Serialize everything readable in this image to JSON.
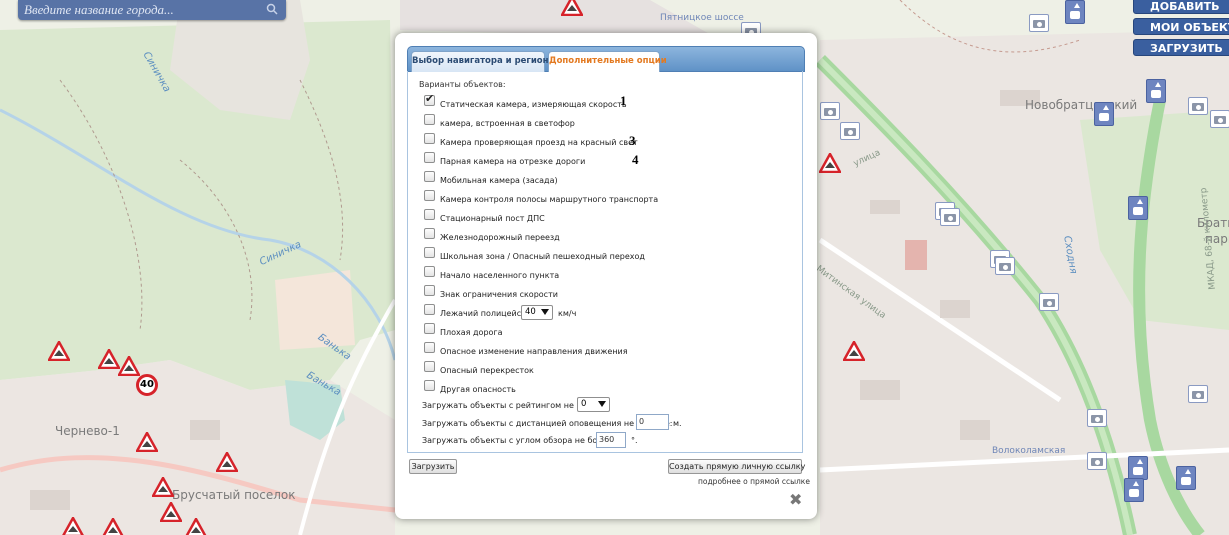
{
  "search": {
    "placeholder": "Введите название города..."
  },
  "top_buttons": [
    "ДОБАВИТЬ",
    "МОИ ОБЪЕКТЫ",
    "ЗАГРУЗИТЬ"
  ],
  "map_labels": {
    "novobratsevsky": "Новобратцевский",
    "chernevo": "Чернево-1",
    "brusyatiy": "Брусчатый поселок",
    "pyatnitskoe": "Пятницкое шоссе",
    "skhodnya": "Сходня",
    "sinichka_1": "Синичка",
    "sinichka_2": "Синичка",
    "banka_1": "Банька",
    "banka_2": "Банька",
    "mitinskaya": "Митинская улица",
    "volokolamskaya": "Волоколамская",
    "bratsevo": "Братцево",
    "park": "парк",
    "mkad": "МКАД, 68-й километр",
    "ulitsa": "улица"
  },
  "speed_sign": "40",
  "dialog": {
    "tabs": [
      {
        "label": "Выбор навигатора и региона",
        "active": false
      },
      {
        "label": "Дополнительные опции",
        "active": true
      }
    ],
    "options_title": "Варианты объектов:",
    "options": [
      {
        "label": "Статическая камера, измеряющая скорость",
        "checked": true
      },
      {
        "label": "камера, встроенная в светофор",
        "checked": false
      },
      {
        "label": "Камера проверяющая проезд на красный свет",
        "checked": false
      },
      {
        "label": "Парная камера на отрезке дороги",
        "checked": false
      },
      {
        "label": "Мобильная камера (засада)",
        "checked": false
      },
      {
        "label": "Камера контроля полосы маршрутного транспорта",
        "checked": false
      },
      {
        "label": "Стационарный пост ДПС",
        "checked": false
      },
      {
        "label": "Железнодорожный переезд",
        "checked": false
      },
      {
        "label": "Школьная зона / Опасный пешеходный переход",
        "checked": false
      },
      {
        "label": "Начало населенного пункта",
        "checked": false
      },
      {
        "label": "Знак ограничения скорости",
        "checked": false
      },
      {
        "label": "Лежачий полицейский",
        "checked": false
      },
      {
        "label": "Плохая дорога",
        "checked": false
      },
      {
        "label": "Опасное изменение направления движения",
        "checked": false
      },
      {
        "label": "Опасный перекресток",
        "checked": false
      },
      {
        "label": "Другая опасность",
        "checked": false
      }
    ],
    "annotations": [
      "1",
      "3",
      "4"
    ],
    "speed_bump_select": {
      "value": "40",
      "unit": "км/ч"
    },
    "rating": {
      "label": "Загружать объекты с рейтингом не ниже:",
      "value": "0"
    },
    "distance": {
      "label": "Загружать объекты с дистанцией оповещения не меньше:",
      "value": "0",
      "unit": "м."
    },
    "angle": {
      "label": "Загружать объекты с углом обзора не больше:",
      "value": "360",
      "unit": "°."
    },
    "load_button": "Загрузить",
    "link_button": "Создать прямую личную ссылку",
    "more_link": "подробнее о прямой ссылке",
    "close": "✖"
  }
}
